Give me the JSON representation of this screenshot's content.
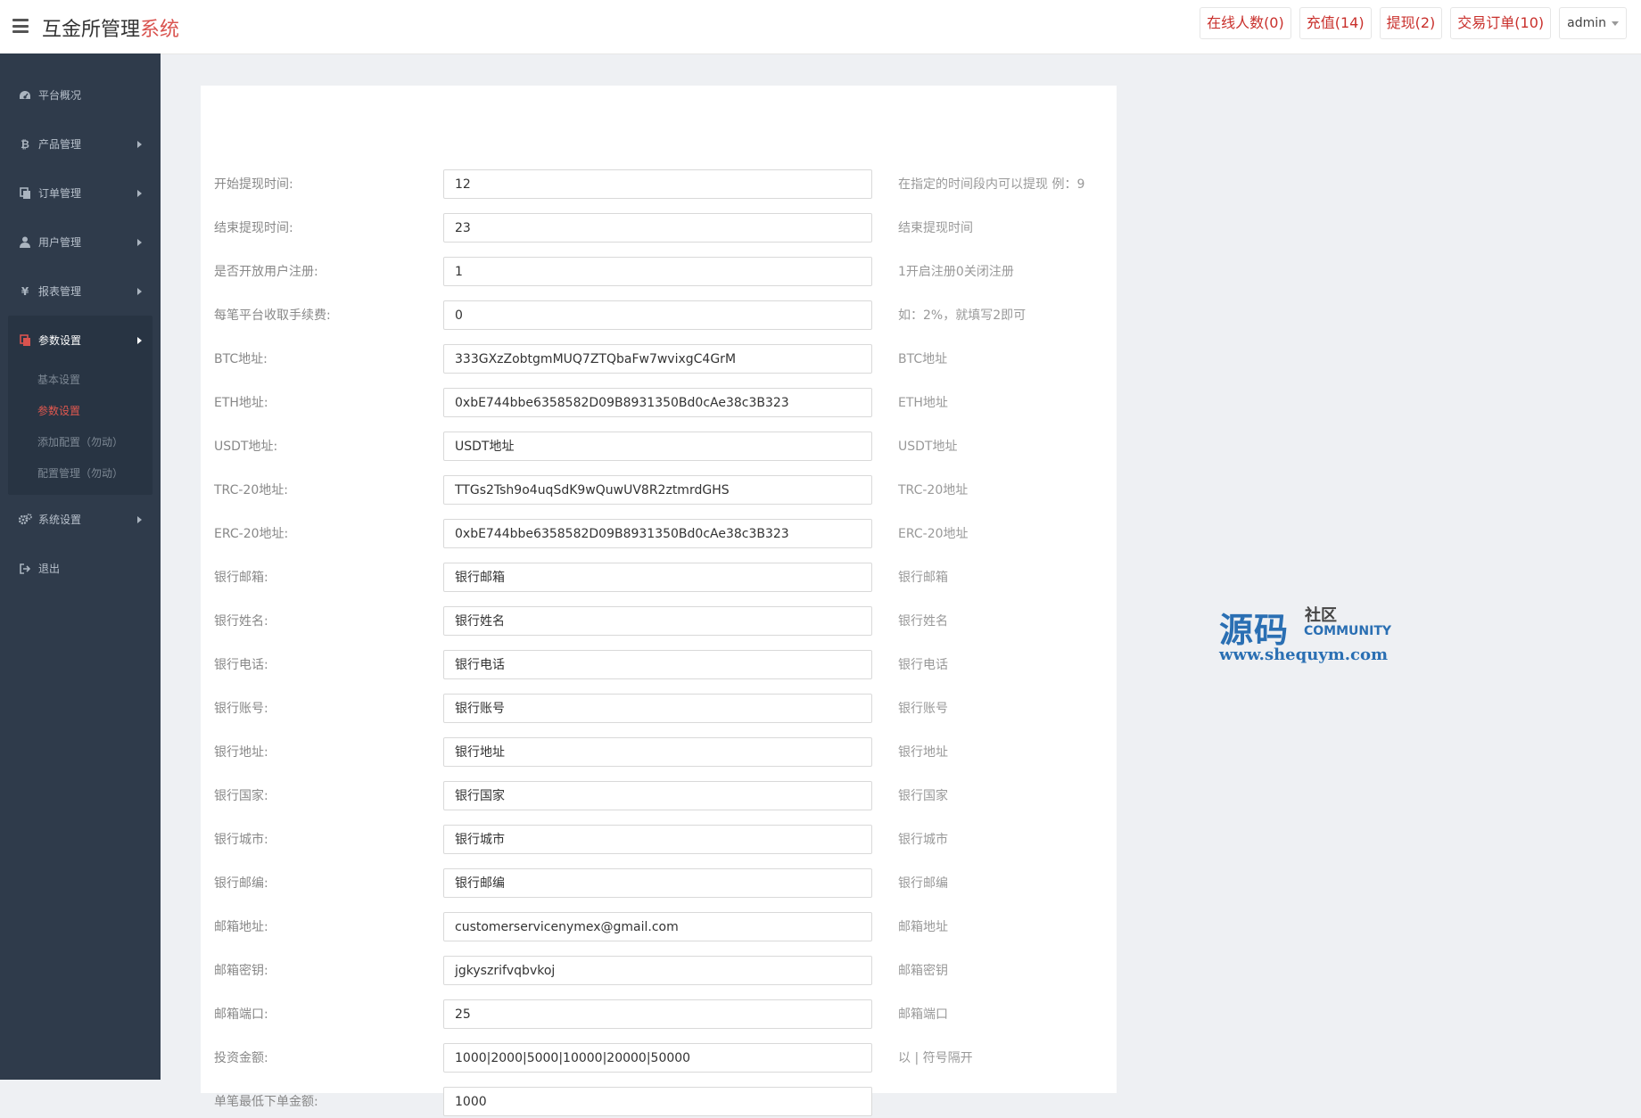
{
  "header": {
    "title_main": "互金所管理",
    "title_accent": "系统",
    "actions": {
      "online": "在线人数(0)",
      "recharge": "充值(14)",
      "withdraw": "提现(2)",
      "orders": "交易订单(10)"
    },
    "user": "admin"
  },
  "sidebar": {
    "items": [
      {
        "label": "平台概况",
        "icon": "dashboard-icon"
      },
      {
        "label": "产品管理",
        "icon": "bitcoin-icon"
      },
      {
        "label": "订单管理",
        "icon": "copy-icon"
      },
      {
        "label": "用户管理",
        "icon": "user-icon"
      },
      {
        "label": "报表管理",
        "icon": "yen-icon"
      },
      {
        "label": "参数设置",
        "icon": "copy-icon"
      },
      {
        "label": "系统设置",
        "icon": "gears-icon"
      },
      {
        "label": "退出",
        "icon": "sign-out-icon"
      }
    ],
    "submenu": [
      {
        "label": "基本设置"
      },
      {
        "label": "参数设置"
      },
      {
        "label": "添加配置（勿动）"
      },
      {
        "label": "配置管理（勿动）"
      }
    ]
  },
  "form": {
    "rows": [
      {
        "label": "开始提现时间:",
        "value": "12",
        "hint": "在指定的时间段内可以提现 例：9"
      },
      {
        "label": "结束提现时间:",
        "value": "23",
        "hint": "结束提现时间"
      },
      {
        "label": "是否开放用户注册:",
        "value": "1",
        "hint": "1开启注册0关闭注册"
      },
      {
        "label": "每笔平台收取手续费:",
        "value": "0",
        "hint": "如：2%，就填写2即可"
      },
      {
        "label": "BTC地址:",
        "value": "333GXzZobtgmMUQ7ZTQbaFw7wvixgC4GrM",
        "hint": "BTC地址"
      },
      {
        "label": "ETH地址:",
        "value": "0xbE744bbe6358582D09B8931350Bd0cAe38c3B323",
        "hint": "ETH地址"
      },
      {
        "label": "USDT地址:",
        "value": "USDT地址",
        "hint": "USDT地址"
      },
      {
        "label": "TRC-20地址:",
        "value": "TTGs2Tsh9o4uqSdK9wQuwUV8R2ztmrdGHS",
        "hint": "TRC-20地址"
      },
      {
        "label": "ERC-20地址:",
        "value": "0xbE744bbe6358582D09B8931350Bd0cAe38c3B323",
        "hint": "ERC-20地址"
      },
      {
        "label": "银行邮箱:",
        "value": "银行邮箱",
        "hint": "银行邮箱"
      },
      {
        "label": "银行姓名:",
        "value": "银行姓名",
        "hint": "银行姓名"
      },
      {
        "label": "银行电话:",
        "value": "银行电话",
        "hint": "银行电话"
      },
      {
        "label": "银行账号:",
        "value": "银行账号",
        "hint": "银行账号"
      },
      {
        "label": "银行地址:",
        "value": "银行地址",
        "hint": "银行地址"
      },
      {
        "label": "银行国家:",
        "value": "银行国家",
        "hint": "银行国家"
      },
      {
        "label": "银行城市:",
        "value": "银行城市",
        "hint": "银行城市"
      },
      {
        "label": "银行邮编:",
        "value": "银行邮编",
        "hint": "银行邮编"
      },
      {
        "label": "邮箱地址:",
        "value": "customerservicenymex@gmail.com",
        "hint": "邮箱地址"
      },
      {
        "label": "邮箱密钥:",
        "value": "jgkyszrifvqbvkoj",
        "hint": "邮箱密钥"
      },
      {
        "label": "邮箱端口:",
        "value": "25",
        "hint": "邮箱端口"
      },
      {
        "label": "投资金额:",
        "value": "1000|2000|5000|10000|20000|50000",
        "hint": "以 | 符号隔开"
      },
      {
        "label": "单笔最低下单金额:",
        "value": "1000",
        "hint": ""
      }
    ]
  },
  "watermark": {
    "big": "源码",
    "small": "社区",
    "community": "COMMUNITY",
    "url": "www.shequym.com"
  }
}
